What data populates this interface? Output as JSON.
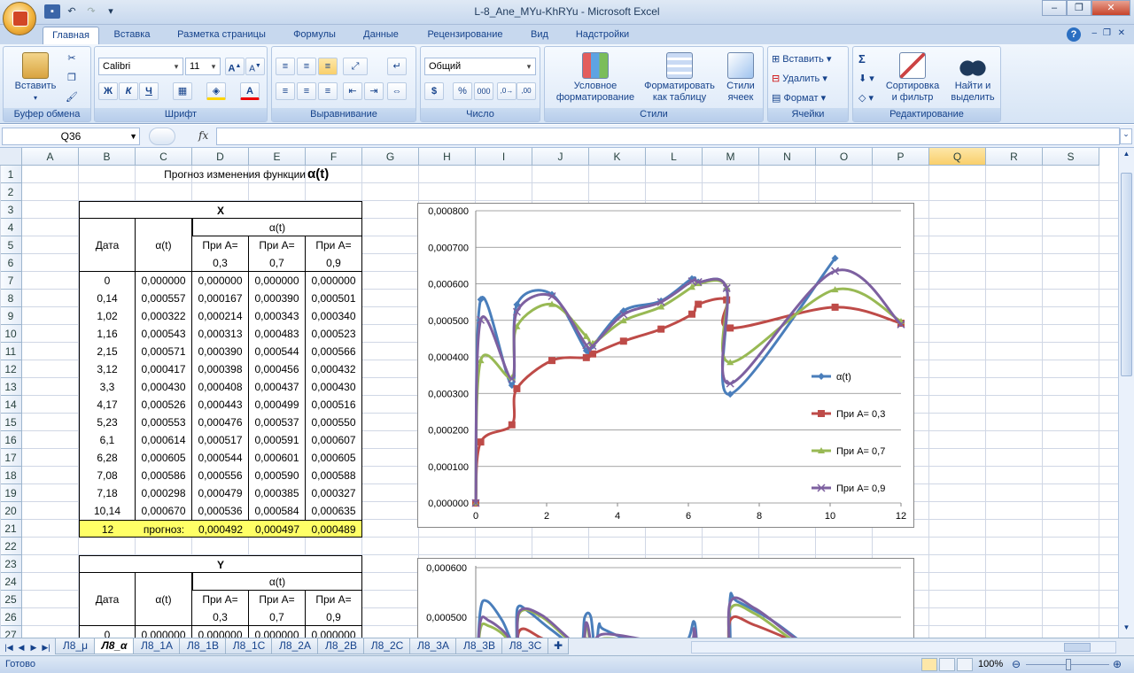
{
  "window": {
    "title": "L-8_Ane_MYu-KhRYu - Microsoft Excel"
  },
  "tabs": [
    "Главная",
    "Вставка",
    "Разметка страницы",
    "Формулы",
    "Данные",
    "Рецензирование",
    "Вид",
    "Надстройки"
  ],
  "ribbon": {
    "clipboard": {
      "paste": "Вставить",
      "label": "Буфер обмена"
    },
    "font": {
      "name": "Calibri",
      "size": "11",
      "bold": "Ж",
      "italic": "К",
      "underline": "Ч",
      "label": "Шрифт"
    },
    "alignment": {
      "label": "Выравнивание"
    },
    "number": {
      "format": "Общий",
      "currency": "$",
      "percent": "%",
      "thousands": "000",
      "label": "Число"
    },
    "styles": {
      "conditional": "Условное",
      "conditional2": "форматирование",
      "table": "Форматировать",
      "table2": "как таблицу",
      "cellstyles": "Стили",
      "cellstyles2": "ячеек",
      "label": "Стили"
    },
    "cells": {
      "insert": "Вставить",
      "delete": "Удалить",
      "format": "Формат",
      "label": "Ячейки"
    },
    "editing": {
      "sigma": "Σ",
      "sort": "Сортировка",
      "sort2": "и фильтр",
      "find": "Найти и",
      "find2": "выделить",
      "label": "Редактирование"
    }
  },
  "formula_bar": {
    "name_box": "Q36",
    "fx": "fx",
    "formula": ""
  },
  "columns": [
    "A",
    "B",
    "C",
    "D",
    "E",
    "F",
    "G",
    "H",
    "I",
    "J",
    "K",
    "L",
    "M",
    "N",
    "O",
    "P",
    "Q",
    "R",
    "S"
  ],
  "rows": [
    "1",
    "2",
    "3",
    "4",
    "5",
    "6",
    "7",
    "8",
    "9",
    "10",
    "11",
    "12",
    "13",
    "14",
    "15",
    "16",
    "17",
    "18",
    "19",
    "20",
    "21",
    "22",
    "23",
    "24",
    "25",
    "26",
    "27"
  ],
  "sheet": {
    "title_text": "Прогноз изменения функции",
    "title_symbol": "α(t)",
    "table_x": {
      "caption": "X",
      "alpha_group": "α(t)",
      "col_date": "Дата",
      "col_alpha": "α(t)",
      "col_prefix": "При А=",
      "a_values": [
        "0,3",
        "0,7",
        "0,9"
      ],
      "rows": [
        [
          "0",
          "0,000000",
          "0,000000",
          "0,000000",
          "0,000000"
        ],
        [
          "0,14",
          "0,000557",
          "0,000167",
          "0,000390",
          "0,000501"
        ],
        [
          "1,02",
          "0,000322",
          "0,000214",
          "0,000343",
          "0,000340"
        ],
        [
          "1,16",
          "0,000543",
          "0,000313",
          "0,000483",
          "0,000523"
        ],
        [
          "2,15",
          "0,000571",
          "0,000390",
          "0,000544",
          "0,000566"
        ],
        [
          "3,12",
          "0,000417",
          "0,000398",
          "0,000456",
          "0,000432"
        ],
        [
          "3,3",
          "0,000430",
          "0,000408",
          "0,000437",
          "0,000430"
        ],
        [
          "4,17",
          "0,000526",
          "0,000443",
          "0,000499",
          "0,000516"
        ],
        [
          "5,23",
          "0,000553",
          "0,000476",
          "0,000537",
          "0,000550"
        ],
        [
          "6,1",
          "0,000614",
          "0,000517",
          "0,000591",
          "0,000607"
        ],
        [
          "6,28",
          "0,000605",
          "0,000544",
          "0,000601",
          "0,000605"
        ],
        [
          "7,08",
          "0,000586",
          "0,000556",
          "0,000590",
          "0,000588"
        ],
        [
          "7,18",
          "0,000298",
          "0,000479",
          "0,000385",
          "0,000327"
        ],
        [
          "10,14",
          "0,000670",
          "0,000536",
          "0,000584",
          "0,000635"
        ]
      ],
      "forecast": [
        "12",
        "прогноз:",
        "0,000492",
        "0,000497",
        "0,000489"
      ]
    },
    "table_y": {
      "caption": "Y",
      "alpha_group": "α(t)",
      "col_date": "Дата",
      "col_alpha": "α(t)",
      "col_prefix": "При А=",
      "a_values": [
        "0,3",
        "0,7",
        "0,9"
      ],
      "partial_row": [
        "0",
        "0,000000",
        "0,000000",
        "0,000000",
        "0,000000"
      ]
    }
  },
  "chart_data": [
    {
      "type": "line",
      "title": "",
      "xlim": [
        0,
        12
      ],
      "ylim": [
        0,
        0.0008
      ],
      "x_ticks": [
        "0",
        "2",
        "4",
        "6",
        "8",
        "10",
        "12"
      ],
      "y_ticks": [
        "0,000000",
        "0,000100",
        "0,000200",
        "0,000300",
        "0,000400",
        "0,000500",
        "0,000600",
        "0,000700",
        "0,000800"
      ],
      "legend": "right",
      "x": [
        0,
        0.14,
        1.02,
        1.16,
        2.15,
        3.12,
        3.3,
        4.17,
        5.23,
        6.1,
        6.28,
        7.08,
        7.18,
        10.14,
        12
      ],
      "series": [
        {
          "name": "α(t)",
          "color": "#4a7ebb",
          "marker": "diamond",
          "values": [
            0,
            0.000557,
            0.000322,
            0.000543,
            0.000571,
            0.000417,
            0.00043,
            0.000526,
            0.000553,
            0.000614,
            0.000605,
            0.000586,
            0.000298,
            0.00067,
            null
          ]
        },
        {
          "name": "При А= 0,3",
          "color": "#be4b48",
          "marker": "square",
          "values": [
            0,
            0.000167,
            0.000214,
            0.000313,
            0.00039,
            0.000398,
            0.000408,
            0.000443,
            0.000476,
            0.000517,
            0.000544,
            0.000556,
            0.000479,
            0.000536,
            0.000492
          ]
        },
        {
          "name": "При А= 0,7",
          "color": "#98b954",
          "marker": "triangle",
          "values": [
            0,
            0.00039,
            0.000343,
            0.000483,
            0.000544,
            0.000456,
            0.000437,
            0.000499,
            0.000537,
            0.000591,
            0.000601,
            0.00059,
            0.000385,
            0.000584,
            0.000497
          ]
        },
        {
          "name": "При А= 0,9",
          "color": "#7d60a0",
          "marker": "x",
          "values": [
            0,
            0.000501,
            0.00034,
            0.000523,
            0.000566,
            0.000432,
            0.00043,
            0.000516,
            0.00055,
            0.000607,
            0.000605,
            0.000588,
            0.000327,
            0.000635,
            0.000489
          ]
        }
      ]
    },
    {
      "type": "line",
      "title": "",
      "ylim": [
        0,
        0.0006
      ],
      "y_ticks": [
        "0,000500",
        "0,000600"
      ],
      "partial": true,
      "series_colors": [
        "#4a7ebb",
        "#be4b48",
        "#98b954",
        "#7d60a0"
      ]
    }
  ],
  "sheet_tabs": [
    "Л8_μ",
    "Л8_α",
    "Л8_1А",
    "Л8_1В",
    "Л8_1С",
    "Л8_2А",
    "Л8_2В",
    "Л8_2С",
    "Л8_3А",
    "Л8_3В",
    "Л8_3С"
  ],
  "active_sheet": "Л8_α",
  "status": {
    "ready": "Готово",
    "zoom": "100%"
  }
}
